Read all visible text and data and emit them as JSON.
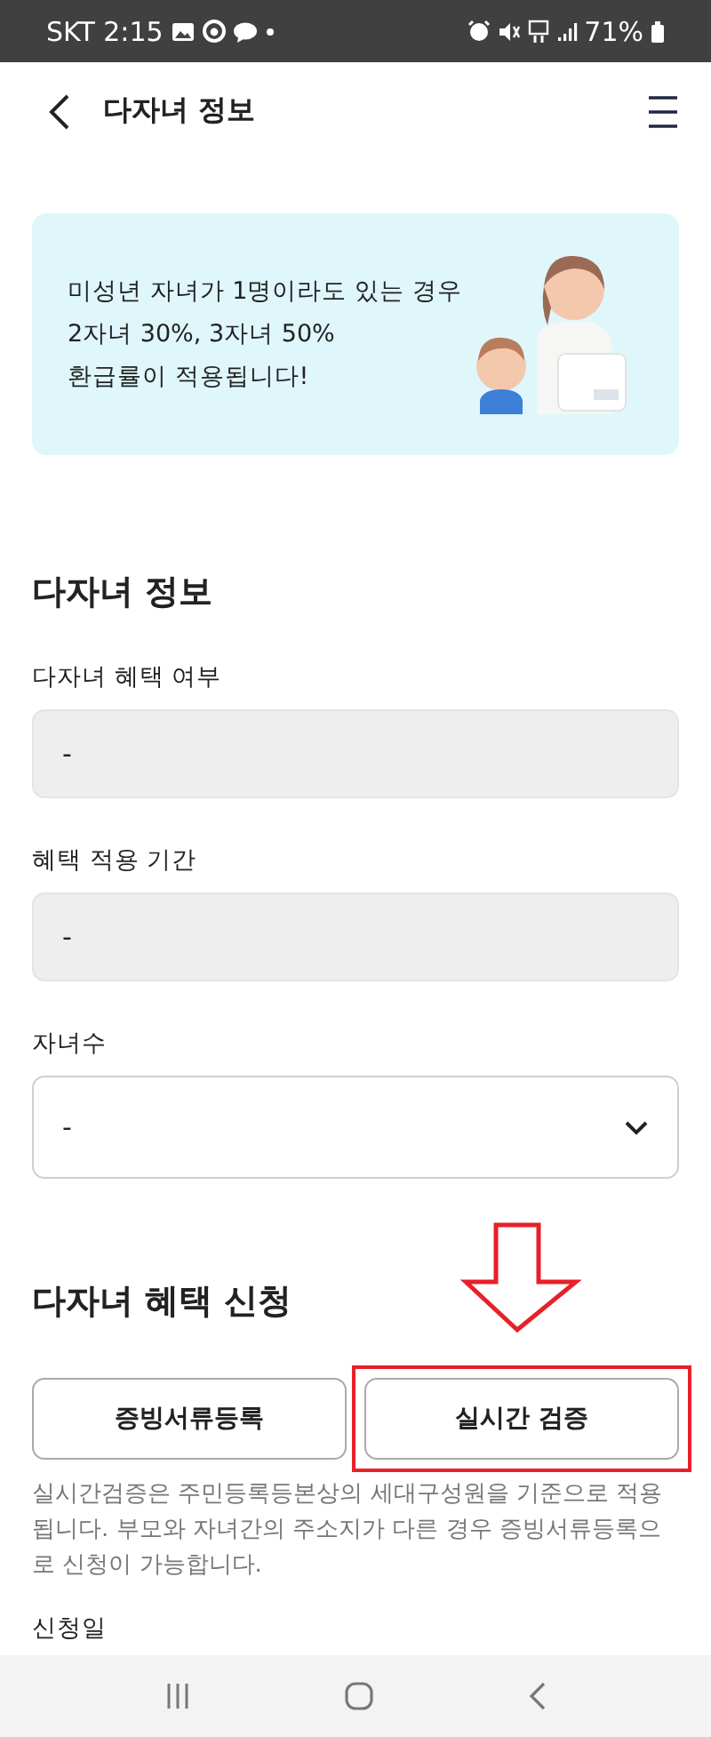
{
  "status_bar": {
    "carrier_time": "SKT 2:15",
    "battery": "71%"
  },
  "header": {
    "title": "다자녀 정보"
  },
  "banner": {
    "lines": [
      "미성년 자녀가 1명이라도 있는 경우",
      "2자녀 30%, 3자녀 50%",
      "환급률이 적용됩니다!"
    ]
  },
  "info_section": {
    "title": "다자녀 정보",
    "fields": [
      {
        "kind": "readonly",
        "label": "다자녀 혜택 여부",
        "value": "-"
      },
      {
        "kind": "readonly",
        "label": "혜택 적용 기간",
        "value": "-"
      },
      {
        "kind": "select",
        "label": "자녀수",
        "value": "-"
      }
    ]
  },
  "apply_section": {
    "title": "다자녀 혜택 신청",
    "buttons": [
      {
        "label": "증빙서류등록",
        "highlighted": false
      },
      {
        "label": "실시간 검증",
        "highlighted": true
      }
    ],
    "note": "실시간검증은 주민등록등본상의 세대구성원을 기준으로 적용됩니다. 부모와 자녀간의 주소지가 다른 경우 증빙서류등록으로 신청이 가능합니다.",
    "next_label": "신청일"
  }
}
